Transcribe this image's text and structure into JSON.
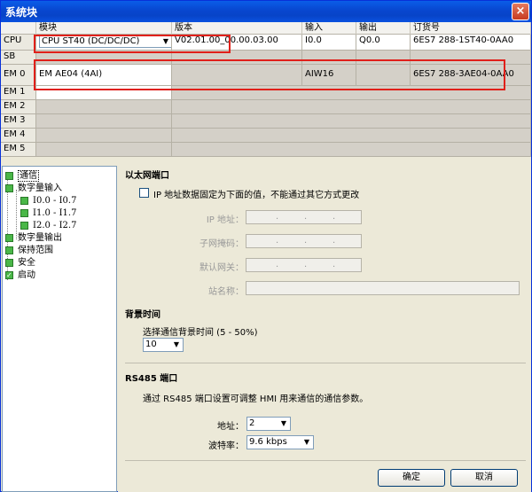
{
  "window": {
    "title": "系统块",
    "close": "×"
  },
  "table": {
    "headers": [
      "模块",
      "版本",
      "输入",
      "输出",
      "订货号"
    ],
    "rows": [
      {
        "label": "CPU",
        "module": "CPU ST40 (DC/DC/DC)",
        "version": "V02.01.00_00.00.03.00",
        "input": "I0.0",
        "output": "Q0.0",
        "order": "6ES7 288-1ST40-0AA0"
      },
      {
        "label": "SB",
        "module": "",
        "version": "",
        "input": "",
        "output": "",
        "order": ""
      },
      {
        "label": "EM 0",
        "module": "EM AE04 (4AI)",
        "version": "",
        "input": "AIW16",
        "output": "",
        "order": "6ES7 288-3AE04-0AA0"
      },
      {
        "label": "EM 1",
        "module": "",
        "version": "",
        "input": "",
        "output": "",
        "order": ""
      },
      {
        "label": "EM 2",
        "module": "",
        "version": "",
        "input": "",
        "output": "",
        "order": ""
      },
      {
        "label": "EM 3",
        "module": "",
        "version": "",
        "input": "",
        "output": "",
        "order": ""
      },
      {
        "label": "EM 4",
        "module": "",
        "version": "",
        "input": "",
        "output": "",
        "order": ""
      },
      {
        "label": "EM 5",
        "module": "",
        "version": "",
        "input": "",
        "output": "",
        "order": ""
      }
    ]
  },
  "tree": {
    "items": [
      "通信",
      "数字量输入",
      "I0.0 - I0.7",
      "I1.0 - I1.7",
      "I2.0 - I2.7",
      "数字量输出",
      "保持范围",
      "安全",
      "启动"
    ]
  },
  "ethernet": {
    "title": "以太网端口",
    "fixed_ip_label": "IP 地址数据固定为下面的值，不能通过其它方式更改",
    "ip_label": "IP 地址：",
    "subnet_label": "子网掩码：",
    "gateway_label": "默认网关：",
    "station_label": "站名称：",
    "dot": "."
  },
  "background": {
    "title": "背景时间",
    "desc": "选择通信背景时间 (5 - 50%)",
    "value": "10"
  },
  "rs485": {
    "title": "RS485 端口",
    "desc": "通过 RS485 端口设置可调整 HMI 用来通信的通信参数。",
    "address_label": "地址：",
    "address_value": "2",
    "baud_label": "波特率：",
    "baud_value": "9.6 kbps"
  },
  "buttons": {
    "ok": "确定",
    "cancel": "取消"
  },
  "colors": {
    "title_bar": "#0846cf",
    "highlight_box": "#e0201a",
    "tree_node": "#4ab748"
  }
}
